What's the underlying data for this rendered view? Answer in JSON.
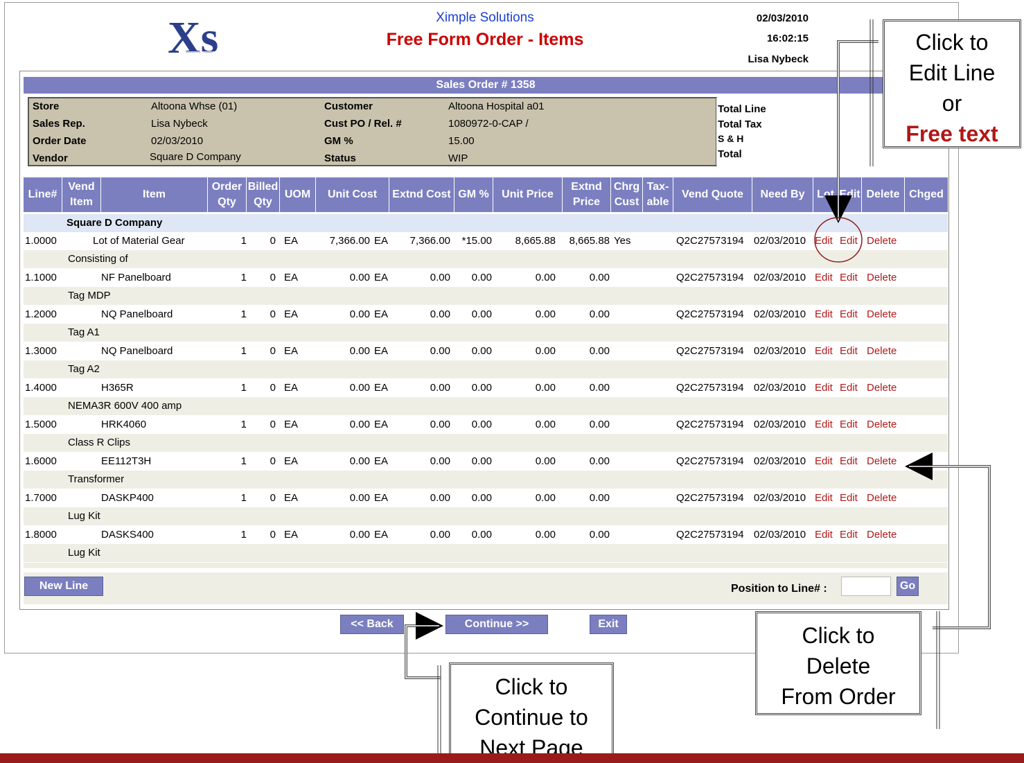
{
  "header": {
    "company": "Ximple Solutions",
    "title": "Free Form Order - Items",
    "date": "02/03/2010",
    "time": "16:02:15",
    "user": "Lisa Nybeck",
    "logo_text": "Xs"
  },
  "order": {
    "title": "Sales Order # 1358",
    "store_label": "Store",
    "store_value": "Altoona Whse (01)",
    "rep_label": "Sales Rep.",
    "rep_value": "Lisa Nybeck",
    "date_label": "Order Date",
    "date_value": "02/03/2010",
    "vendor_label": "Vendor",
    "vendor_value": "Square D Company",
    "customer_label": "Customer",
    "customer_value": "Altoona Hospital a01",
    "po_label": "Cust PO / Rel. #",
    "po_value": "1080972-0-CAP /",
    "gm_label": "GM %",
    "gm_value": "15.00",
    "status_label": "Status",
    "status_value": "WIP",
    "total_line_label": "Total Line",
    "total_tax_label": "Total Tax",
    "sh_label": "S & H",
    "total_label": "Total"
  },
  "columns": {
    "line": "Line#",
    "vend_item": "Vend Item",
    "item": "Item",
    "order_qty": "Order Qty",
    "billed_qty": "Billed Qty",
    "uom": "UOM",
    "unit_cost": "Unit Cost",
    "extnd_cost": "Extnd Cost",
    "gm": "GM %",
    "unit_price": "Unit Price",
    "extnd_price": "Extnd Price",
    "chrg_cust": "Chrg Cust",
    "taxable": "Tax-able",
    "vend_quote": "Vend Quote",
    "need_by": "Need By",
    "lot": "Lot",
    "edit": "Edit",
    "delete": "Delete",
    "chged": "Chged"
  },
  "group_name": "Square D Company",
  "rows": [
    {
      "line": "1.0000",
      "item": "Lot of Material Gear",
      "order_qty": "1",
      "billed_qty": "0",
      "uom": "EA",
      "unit_cost": "7,366.00",
      "cost_uom": "EA",
      "extnd_cost": "7,366.00",
      "gm": "*15.00",
      "unit_price": "8,665.88",
      "extnd_price": "8,665.88",
      "chrg_cust": "Yes",
      "quote": "Q2C27573194",
      "need_by": "02/03/2010",
      "lot": "Edit",
      "edit": "Edit",
      "delete": "Delete",
      "desc": "Consisting of"
    },
    {
      "line": "1.1000",
      "item": "NF Panelboard",
      "order_qty": "1",
      "billed_qty": "0",
      "uom": "EA",
      "unit_cost": "0.00",
      "cost_uom": "EA",
      "extnd_cost": "0.00",
      "gm": "0.00",
      "unit_price": "0.00",
      "extnd_price": "0.00",
      "chrg_cust": "",
      "quote": "Q2C27573194",
      "need_by": "02/03/2010",
      "lot": "Edit",
      "edit": "Edit",
      "delete": "Delete",
      "desc": "Tag MDP"
    },
    {
      "line": "1.2000",
      "item": "NQ Panelboard",
      "order_qty": "1",
      "billed_qty": "0",
      "uom": "EA",
      "unit_cost": "0.00",
      "cost_uom": "EA",
      "extnd_cost": "0.00",
      "gm": "0.00",
      "unit_price": "0.00",
      "extnd_price": "0.00",
      "chrg_cust": "",
      "quote": "Q2C27573194",
      "need_by": "02/03/2010",
      "lot": "Edit",
      "edit": "Edit",
      "delete": "Delete",
      "desc": "Tag A1"
    },
    {
      "line": "1.3000",
      "item": "NQ Panelboard",
      "order_qty": "1",
      "billed_qty": "0",
      "uom": "EA",
      "unit_cost": "0.00",
      "cost_uom": "EA",
      "extnd_cost": "0.00",
      "gm": "0.00",
      "unit_price": "0.00",
      "extnd_price": "0.00",
      "chrg_cust": "",
      "quote": "Q2C27573194",
      "need_by": "02/03/2010",
      "lot": "Edit",
      "edit": "Edit",
      "delete": "Delete",
      "desc": "Tag A2"
    },
    {
      "line": "1.4000",
      "item": "H365R",
      "order_qty": "1",
      "billed_qty": "0",
      "uom": "EA",
      "unit_cost": "0.00",
      "cost_uom": "EA",
      "extnd_cost": "0.00",
      "gm": "0.00",
      "unit_price": "0.00",
      "extnd_price": "0.00",
      "chrg_cust": "",
      "quote": "Q2C27573194",
      "need_by": "02/03/2010",
      "lot": "Edit",
      "edit": "Edit",
      "delete": "Delete",
      "desc": "NEMA3R 600V 400 amp"
    },
    {
      "line": "1.5000",
      "item": "HRK4060",
      "order_qty": "1",
      "billed_qty": "0",
      "uom": "EA",
      "unit_cost": "0.00",
      "cost_uom": "EA",
      "extnd_cost": "0.00",
      "gm": "0.00",
      "unit_price": "0.00",
      "extnd_price": "0.00",
      "chrg_cust": "",
      "quote": "Q2C27573194",
      "need_by": "02/03/2010",
      "lot": "Edit",
      "edit": "Edit",
      "delete": "Delete",
      "desc": "Class R Clips"
    },
    {
      "line": "1.6000",
      "item": "EE112T3H",
      "order_qty": "1",
      "billed_qty": "0",
      "uom": "EA",
      "unit_cost": "0.00",
      "cost_uom": "EA",
      "extnd_cost": "0.00",
      "gm": "0.00",
      "unit_price": "0.00",
      "extnd_price": "0.00",
      "chrg_cust": "",
      "quote": "Q2C27573194",
      "need_by": "02/03/2010",
      "lot": "Edit",
      "edit": "Edit",
      "delete": "Delete",
      "desc": "Transformer"
    },
    {
      "line": "1.7000",
      "item": "DASKP400",
      "order_qty": "1",
      "billed_qty": "0",
      "uom": "EA",
      "unit_cost": "0.00",
      "cost_uom": "EA",
      "extnd_cost": "0.00",
      "gm": "0.00",
      "unit_price": "0.00",
      "extnd_price": "0.00",
      "chrg_cust": "",
      "quote": "Q2C27573194",
      "need_by": "02/03/2010",
      "lot": "Edit",
      "edit": "Edit",
      "delete": "Delete",
      "desc": "Lug Kit"
    },
    {
      "line": "1.8000",
      "item": "DASKS400",
      "order_qty": "1",
      "billed_qty": "0",
      "uom": "EA",
      "unit_cost": "0.00",
      "cost_uom": "EA",
      "extnd_cost": "0.00",
      "gm": "0.00",
      "unit_price": "0.00",
      "extnd_price": "0.00",
      "chrg_cust": "",
      "quote": "Q2C27573194",
      "need_by": "02/03/2010",
      "lot": "Edit",
      "edit": "Edit",
      "delete": "Delete",
      "desc": "Lug Kit"
    }
  ],
  "footer": {
    "new_line": "New Line",
    "position_label": "Position to Line# :",
    "go": "Go",
    "back": "<< Back",
    "continue": "Continue >>",
    "exit": "Exit"
  },
  "callouts": {
    "edit_l1": "Click to",
    "edit_l2": "Edit Line",
    "edit_l3": "or",
    "edit_l4": "Free text",
    "delete_l1": "Click to",
    "delete_l2": "Delete",
    "delete_l3": "From Order",
    "continue_l1": "Click to",
    "continue_l2": "Continue to",
    "continue_l3": "Next Page"
  },
  "colors": {
    "header_bar": "#7b7fc0",
    "title_red": "#cc0000",
    "company_blue": "#1a3fd0",
    "link_red": "#b01818",
    "info_panel": "#c9c3ad",
    "accent_bar": "#9b1b1b"
  }
}
